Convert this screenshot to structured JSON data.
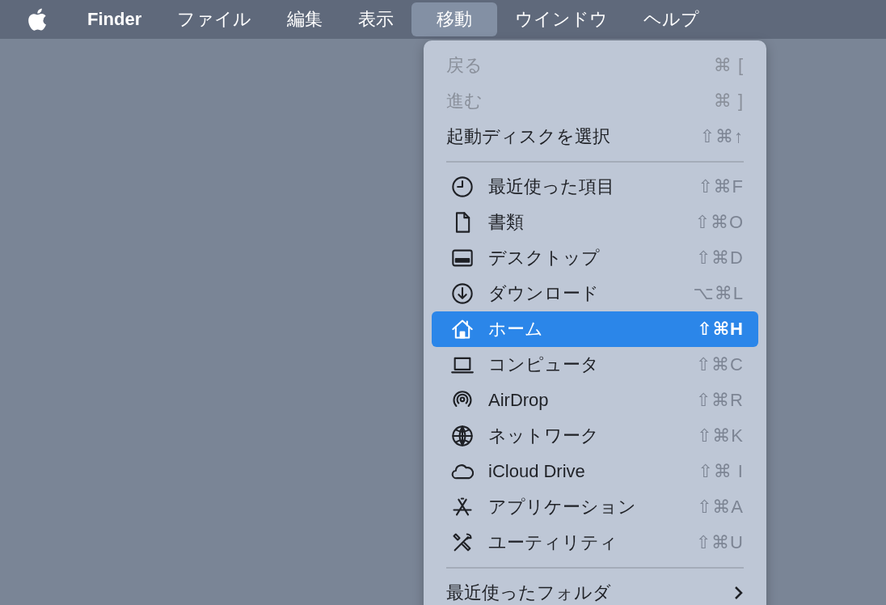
{
  "menu_bar": {
    "items": [
      {
        "label": "Finder",
        "selected": false,
        "bold": true
      },
      {
        "label": "ファイル",
        "selected": false,
        "bold": false
      },
      {
        "label": "編集",
        "selected": false,
        "bold": false
      },
      {
        "label": "表示",
        "selected": false,
        "bold": false
      },
      {
        "label": "移動",
        "selected": true,
        "bold": false
      },
      {
        "label": "ウインドウ",
        "selected": false,
        "bold": false
      },
      {
        "label": "ヘルプ",
        "selected": false,
        "bold": false
      }
    ]
  },
  "menu": {
    "sections": [
      {
        "items": [
          {
            "label": "戻る",
            "shortcut": "⌘ [",
            "disabled": true,
            "selected": false
          },
          {
            "label": "進む",
            "shortcut": "⌘ ]",
            "disabled": true,
            "selected": false
          },
          {
            "label": "起動ディスクを選択",
            "shortcut": "⇧⌘↑",
            "disabled": false,
            "selected": false
          }
        ]
      },
      {
        "items": [
          {
            "label": "最近使った項目",
            "shortcut": "⇧⌘F",
            "disabled": false,
            "selected": false
          },
          {
            "label": "書類",
            "shortcut": "⇧⌘O",
            "disabled": false,
            "selected": false
          },
          {
            "label": "デスクトップ",
            "shortcut": "⇧⌘D",
            "disabled": false,
            "selected": false
          },
          {
            "label": "ダウンロード",
            "shortcut": "⌥⌘L",
            "disabled": false,
            "selected": false
          },
          {
            "label": "ホーム",
            "shortcut": "⇧⌘H",
            "disabled": false,
            "selected": true
          },
          {
            "label": "コンピュータ",
            "shortcut": "⇧⌘C",
            "disabled": false,
            "selected": false
          },
          {
            "label": "AirDrop",
            "shortcut": "⇧⌘R",
            "disabled": false,
            "selected": false
          },
          {
            "label": "ネットワーク",
            "shortcut": "⇧⌘K",
            "disabled": false,
            "selected": false
          },
          {
            "label": "iCloud Drive",
            "shortcut": "⇧⌘ I",
            "disabled": false,
            "selected": false
          },
          {
            "label": "アプリケーション",
            "shortcut": "⇧⌘A",
            "disabled": false,
            "selected": false
          },
          {
            "label": "ユーティリティ",
            "shortcut": "⇧⌘U",
            "disabled": false,
            "selected": false
          }
        ]
      },
      {
        "items": [
          {
            "label": "最近使ったフォルダ",
            "submenu": true,
            "disabled": false,
            "selected": false
          }
        ]
      }
    ]
  }
}
